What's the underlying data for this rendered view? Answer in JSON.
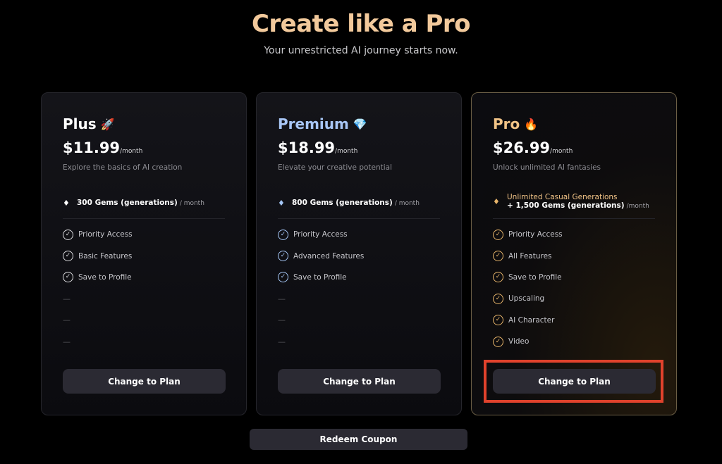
{
  "header": {
    "title": "Create like a Pro",
    "subtitle": "Your unrestricted AI journey starts now."
  },
  "plans": [
    {
      "name": "Plus",
      "emoji": "🚀",
      "name_color": "#ffffff",
      "price": "$11.99",
      "per": "/month",
      "description": "Explore the basics of AI creation",
      "gems": "300 Gems (generations)",
      "gems_unit": "/ month",
      "features": [
        "Priority Access",
        "Basic Features",
        "Save to Profile",
        "—",
        "—",
        "—"
      ],
      "button": "Change to Plan"
    },
    {
      "name": "Premium",
      "emoji": "💎",
      "name_color": "#a8c6f5",
      "price": "$18.99",
      "per": "/month",
      "description": "Elevate your creative potential",
      "gems": "800 Gems (generations)",
      "gems_unit": "/ month",
      "features": [
        "Priority Access",
        "Advanced Features",
        "Save to Profile",
        "—",
        "—",
        "—"
      ],
      "button": "Change to Plan"
    },
    {
      "name": "Pro",
      "emoji": "🔥",
      "name_color": "#f2c487",
      "price": "$26.99",
      "per": "/month",
      "description": "Unlock unlimited AI fantasies",
      "unlimited": "Unlimited Casual Generations",
      "gems": "+ 1,500 Gems (generations)",
      "gems_unit": "/month",
      "features": [
        "Priority Access",
        "All Features",
        "Save to Profile",
        "Upscaling",
        "AI Character",
        "Video"
      ],
      "button": "Change to Plan"
    }
  ],
  "coupon_button": "Redeem Coupon",
  "colors": {
    "title": "#f2c99b",
    "highlight": "#e0422c",
    "button_bg": "#2b2a33"
  }
}
